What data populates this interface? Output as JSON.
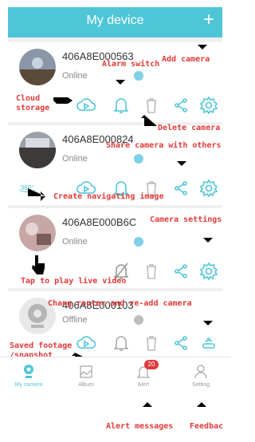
{
  "header": {
    "title": "My device",
    "add_symbol": "+"
  },
  "devices": [
    {
      "id": "406A8E000563",
      "status": "Online"
    },
    {
      "id": "406A8E000824",
      "status": "Online"
    },
    {
      "id": "406A8E000B6C",
      "status": "Online"
    },
    {
      "id": "406A8E000103",
      "status": "Offline"
    }
  ],
  "badges": {
    "three_sixty": "360°"
  },
  "tabs": [
    {
      "label": "My camera",
      "active": true
    },
    {
      "label": "Album",
      "active": false
    },
    {
      "label": "Alert",
      "active": false,
      "badge": "20"
    },
    {
      "label": "Setting",
      "active": false
    }
  ],
  "annotations": {
    "add_camera": "Add camera",
    "alarm_switch": "Alarm switch",
    "cloud_storage": "Cloud\nstorage",
    "delete_camera": "Delete camera",
    "share_camera": "Share camera with others",
    "create_nav_image": "Create navigating image",
    "camera_settings": "Camera settings",
    "tap_play": "Tap to play live video",
    "router_readd": "Chang router and re-add camera",
    "saved_footage": "Saved footage\n/snapshot",
    "alert_messages": "Alert messages",
    "feedback": "Feedbac"
  },
  "colors": {
    "accent": "#4fc6d8",
    "annotation": "#e23a3a"
  }
}
